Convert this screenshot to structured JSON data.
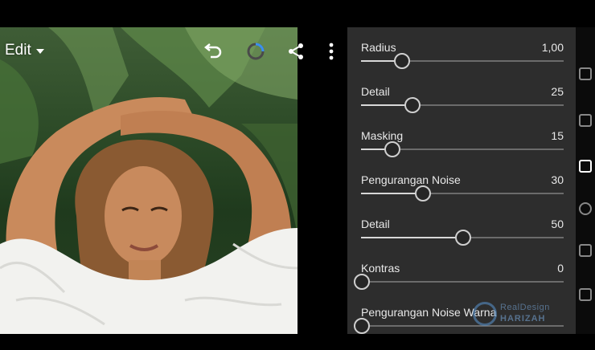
{
  "header": {
    "edit_label": "Edit",
    "icons": [
      "undo-icon",
      "loading-spinner-icon",
      "share-icon",
      "more-vertical-icon"
    ]
  },
  "photo": {
    "description_icon": "portrait-photo"
  },
  "detail_panel": {
    "sliders": [
      {
        "label": "Radius",
        "value": "1,00",
        "fraction": 0.2
      },
      {
        "label": "Detail",
        "value": "25",
        "fraction": 0.25
      },
      {
        "label": "Masking",
        "value": "15",
        "fraction": 0.15
      },
      {
        "label": "Pengurangan Noise",
        "value": "30",
        "fraction": 0.3
      },
      {
        "label": "Detail",
        "value": "50",
        "fraction": 0.5
      },
      {
        "label": "Kontras",
        "value": "0",
        "fraction": 0.0
      },
      {
        "label": "Pengurangan Noise Warna",
        "value": "",
        "fraction": 0.0
      }
    ]
  },
  "colors": {
    "panel_bg": "#2d2d2d",
    "track": "#6b6b6b",
    "accent": "#d8d8d8"
  },
  "watermark": {
    "line1": "RealDesign",
    "line2": "HARIZAH"
  }
}
